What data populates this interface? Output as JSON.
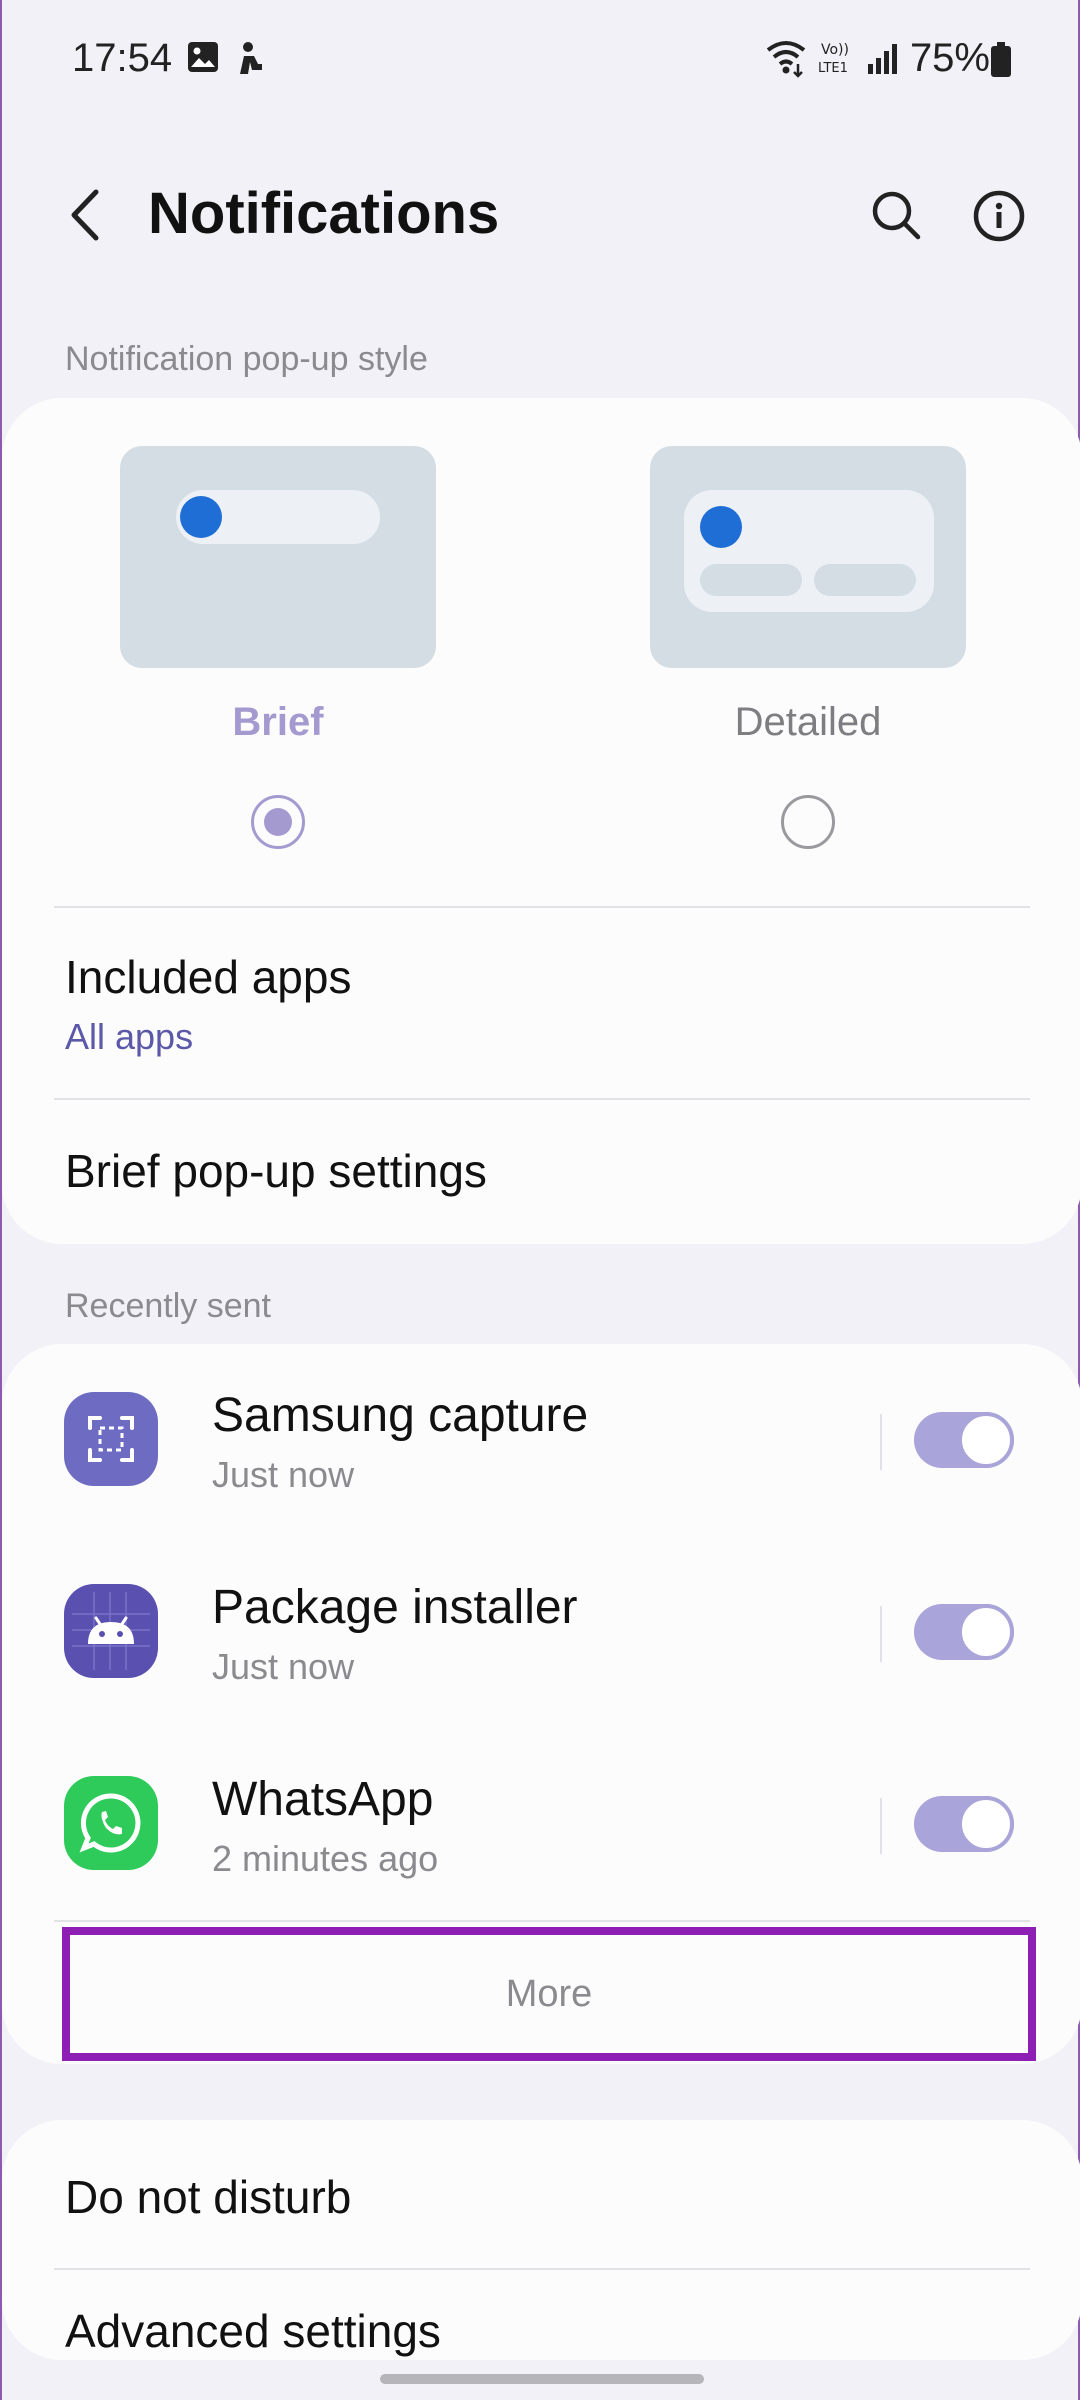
{
  "status_bar": {
    "time": "17:54",
    "battery_text": "75%",
    "icons": [
      "gallery-icon",
      "app-icon",
      "wifi-icon",
      "volte-icon",
      "signal-icon",
      "battery-icon"
    ]
  },
  "app_bar": {
    "title": "Notifications",
    "icons": [
      "back-icon",
      "search-icon",
      "info-icon"
    ]
  },
  "popup_style": {
    "header": "Notification pop-up style",
    "options": [
      {
        "label": "Brief",
        "selected": true
      },
      {
        "label": "Detailed",
        "selected": false
      }
    ],
    "included_apps": {
      "title": "Included apps",
      "value": "All apps"
    },
    "brief_settings": {
      "title": "Brief pop-up settings"
    }
  },
  "recently_sent": {
    "header": "Recently sent",
    "apps": [
      {
        "name": "Samsung capture",
        "time": "Just now",
        "enabled": true,
        "icon": "samsung-capture-icon"
      },
      {
        "name": "Package installer",
        "time": "Just now",
        "enabled": true,
        "icon": "package-installer-icon"
      },
      {
        "name": "WhatsApp",
        "time": "2 minutes ago",
        "enabled": true,
        "icon": "whatsapp-icon"
      }
    ],
    "more_label": "More"
  },
  "bottom_card": {
    "items": [
      {
        "label": "Do not disturb"
      },
      {
        "label": "Advanced settings"
      }
    ]
  },
  "colors": {
    "background": "#f2f1f7",
    "card": "#fcfcfd",
    "accent": "#a49ad0",
    "link": "#5b58a8",
    "toggle_on": "#a9a5da",
    "highlight_box": "#8d1fb5"
  }
}
